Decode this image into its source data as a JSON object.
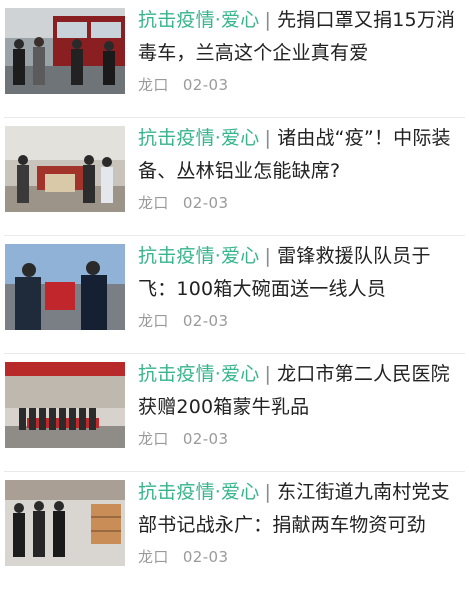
{
  "feed": {
    "items": [
      {
        "tag": "抗击疫情·爱心",
        "separator": "|",
        "title": "先捐口罩又捐15万消毒车，兰高这个企业真有爱",
        "source": "龙口",
        "date": "02-03",
        "image": "people-handing-over-disinfection-vehicle"
      },
      {
        "tag": "抗击疫情·爱心",
        "separator": "|",
        "title": "诸由战“疫”！中际装备、丛林铝业怎能缺席?",
        "source": "龙口",
        "date": "02-03",
        "image": "workers-with-donated-supplies"
      },
      {
        "tag": "抗击疫情·爱心",
        "separator": "|",
        "title": "雷锋救援队队员于飞：100箱大碗面送一线人员",
        "source": "龙口",
        "date": "02-03",
        "image": "rescue-team-handing-over-boxes"
      },
      {
        "tag": "抗击疫情·爱心",
        "separator": "|",
        "title": "龙口市第二人民医院获赠200箱蒙牛乳品",
        "source": "龙口",
        "date": "02-03",
        "image": "group-photo-in-front-of-hospital"
      },
      {
        "tag": "抗击疫情·爱心",
        "separator": "|",
        "title": "东江街道九南村党支部书记战永广：捐献两车物资可劲",
        "source": "龙口",
        "date": "02-03",
        "image": "people-with-stacked-boxes"
      }
    ]
  },
  "colors": {
    "tag": "#37b58a",
    "title": "#222222",
    "meta": "#9a9a9a",
    "divider": "#e9e9e9"
  }
}
